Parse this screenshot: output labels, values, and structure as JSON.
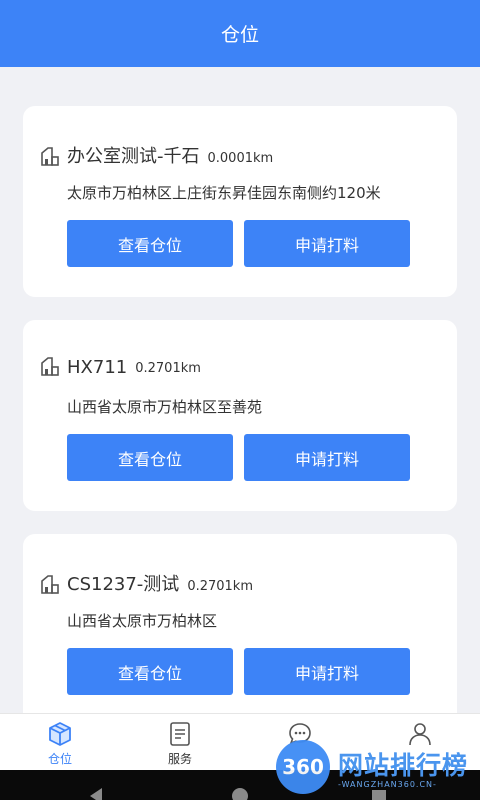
{
  "header": {
    "title": "仓位"
  },
  "cards": [
    {
      "name": "办公室测试-千石",
      "distance": "0.0001km",
      "address": "太原市万柏林区上庄街东昇佳园东南侧约120米",
      "view_label": "查看仓位",
      "apply_label": "申请打料"
    },
    {
      "name": "HX711",
      "distance": "0.2701km",
      "address": "山西省太原市万柏林区至善苑",
      "view_label": "查看仓位",
      "apply_label": "申请打料"
    },
    {
      "name": "CS1237-测试",
      "distance": "0.2701km",
      "address": "山西省太原市万柏林区",
      "view_label": "查看仓位",
      "apply_label": "申请打料"
    }
  ],
  "tabbar": {
    "tabs": [
      {
        "label": "仓位",
        "icon": "box-icon",
        "active": true
      },
      {
        "label": "服务",
        "icon": "document-icon"
      },
      {
        "label": "",
        "icon": "chat-icon"
      },
      {
        "label": "",
        "icon": "user-icon"
      }
    ]
  },
  "watermark": {
    "badge": "360",
    "title": "网站排行榜",
    "subtitle": "-WANGZHAN360.CN-"
  },
  "colors": {
    "primary": "#3d83f7",
    "background": "#f0f1f5",
    "card": "#ffffff",
    "text": "#333333"
  }
}
